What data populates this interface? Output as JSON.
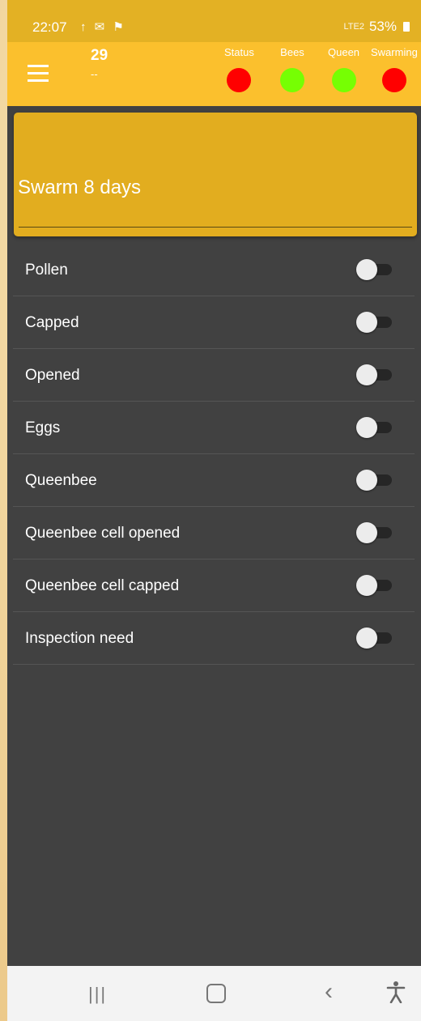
{
  "status_bar": {
    "time": "22:07",
    "left_icons": "↑ ✉ ⚑",
    "signal_text": "LTE2",
    "battery": "53%"
  },
  "app_bar": {
    "hive_number": "29",
    "hive_subtitle": "--",
    "indicators": [
      {
        "label": "Status",
        "color": "#ff0000"
      },
      {
        "label": "Bees",
        "color": "#76ff03"
      },
      {
        "label": "Queen",
        "color": "#76ff03"
      },
      {
        "label": "Swarming",
        "color": "#ff0000"
      }
    ]
  },
  "card": {
    "title": "Swarm 8 days"
  },
  "toggles": [
    {
      "label": "Pollen",
      "on": false
    },
    {
      "label": "Capped",
      "on": false
    },
    {
      "label": "Opened",
      "on": false
    },
    {
      "label": "Eggs",
      "on": false
    },
    {
      "label": "Queenbee",
      "on": false
    },
    {
      "label": "Queenbee cell opened",
      "on": false
    },
    {
      "label": "Queenbee cell capped",
      "on": false
    },
    {
      "label": "Inspection need",
      "on": false
    }
  ],
  "nav_bar": {
    "recents_icon": "|||",
    "back_icon": "‹",
    "accessibility_icon": "♿"
  }
}
